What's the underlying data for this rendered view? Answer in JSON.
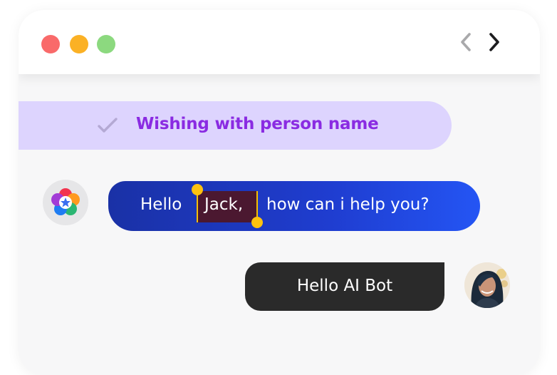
{
  "window": {
    "controls": [
      "close",
      "minimize",
      "maximize"
    ],
    "nav": {
      "back_icon": "chevron-left-icon",
      "forward_icon": "chevron-right-icon"
    }
  },
  "tag": {
    "icon": "checkmark-icon",
    "label": "Wishing with person name"
  },
  "bot_message": {
    "avatar": "bot-flower-logo",
    "greeting": "Hello",
    "highlighted_name": "Jack,",
    "rest": "how can i help you?"
  },
  "user_message": {
    "text": "Hello AI Bot",
    "avatar": "user-photo"
  },
  "colors": {
    "close": "#f96a6a",
    "minimize": "#fbb125",
    "maximize": "#8cd97f",
    "tag_bg": "#ddd4fe",
    "tag_text": "#8a2be2",
    "bot_bubble_start": "#1a31a6",
    "bot_bubble_end": "#2455f4",
    "highlight_bg": "#4b1830",
    "selection_handle": "#fec20f",
    "user_bubble": "#2a2a2a"
  }
}
